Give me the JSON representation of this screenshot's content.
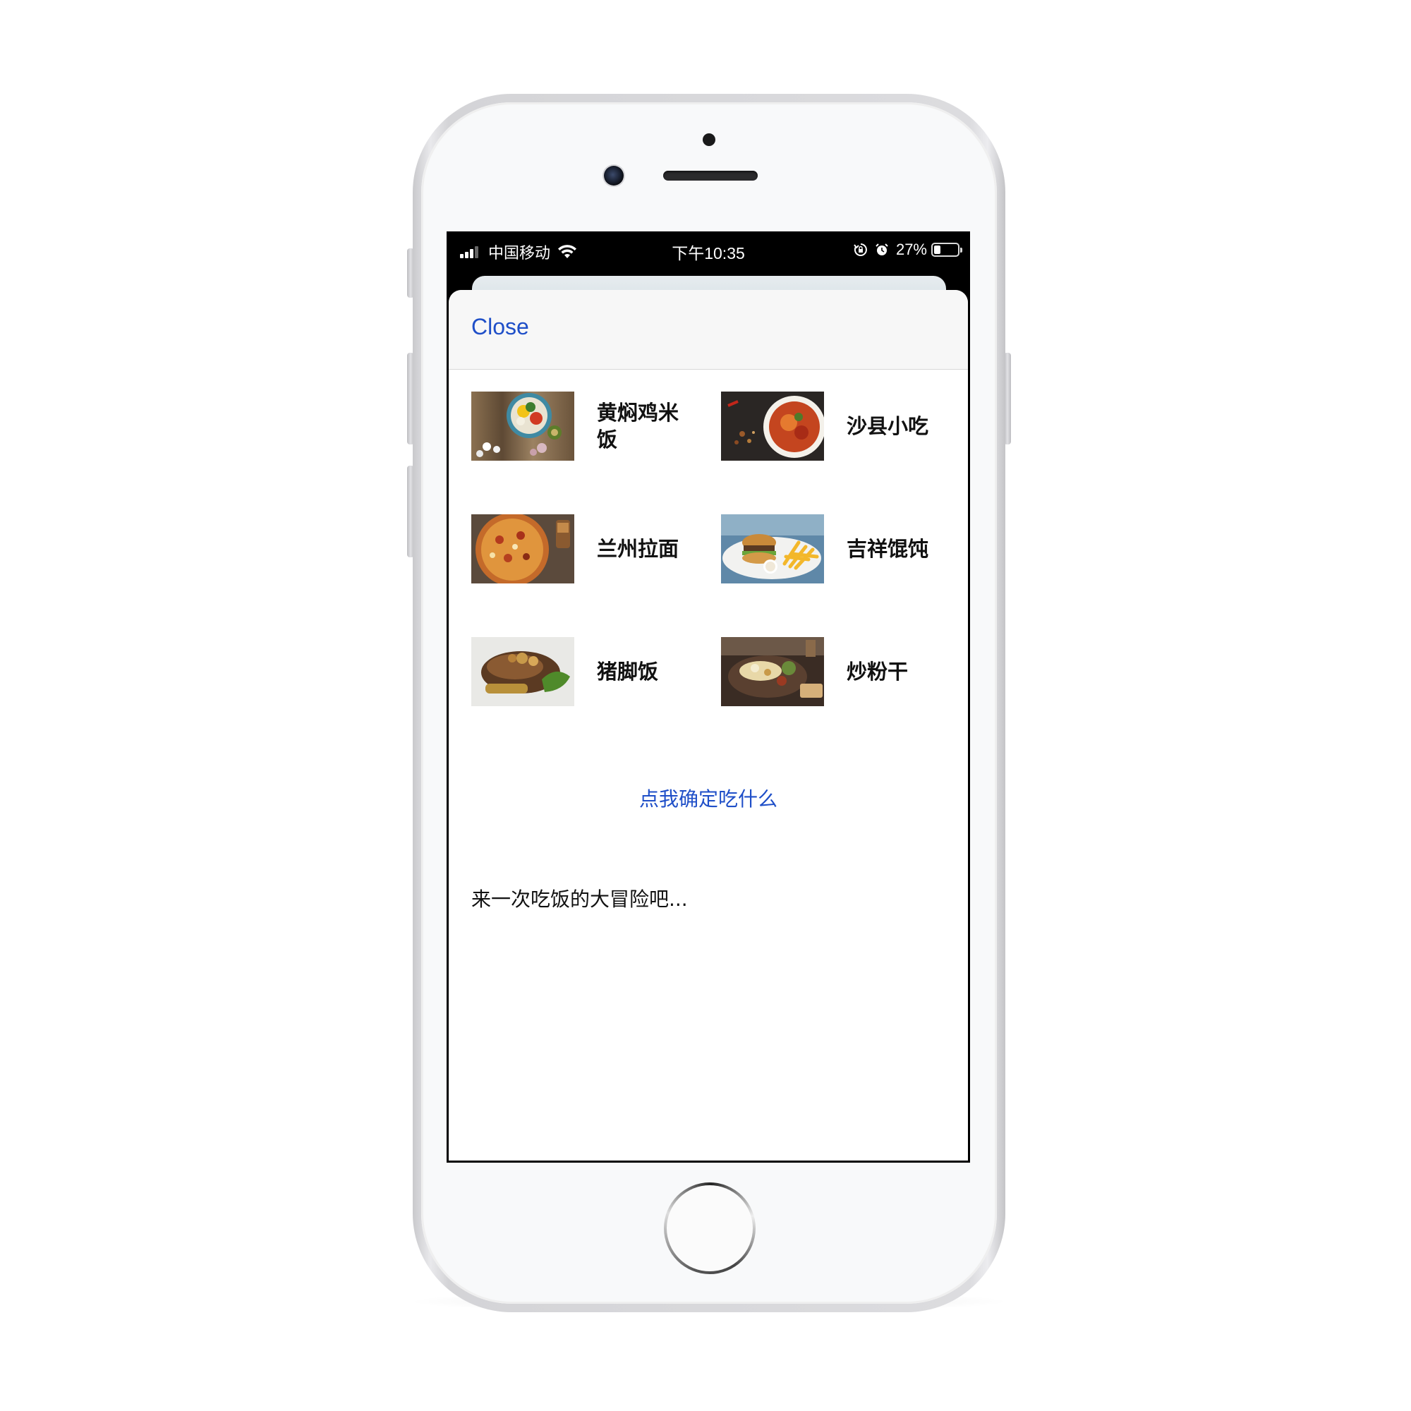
{
  "status_bar": {
    "carrier": "中国移动",
    "time": "下午10:35",
    "battery_percent_label": "27%",
    "battery_level": 0.27,
    "icons": [
      "signal-icon",
      "wifi-icon",
      "orientation-lock-icon",
      "alarm-icon",
      "battery-icon"
    ]
  },
  "sheet": {
    "close_label": "Close"
  },
  "foods": [
    {
      "name": "黄焖鸡米饭",
      "icon": "food-photo-bowl"
    },
    {
      "name": "沙县小吃",
      "icon": "food-photo-soup"
    },
    {
      "name": "兰州拉面",
      "icon": "food-photo-pizza"
    },
    {
      "name": "吉祥馄饨",
      "icon": "food-photo-burger-fries"
    },
    {
      "name": "猪脚饭",
      "icon": "food-photo-pork"
    },
    {
      "name": "炒粉干",
      "icon": "food-photo-platter"
    }
  ],
  "actions": {
    "decide_label": "点我确定吃什么"
  },
  "result_text": "来一次吃饭的大冒险吧...",
  "colors": {
    "accent": "#1f4fc8",
    "text": "#111111",
    "header_bg": "#f7f7f7"
  }
}
